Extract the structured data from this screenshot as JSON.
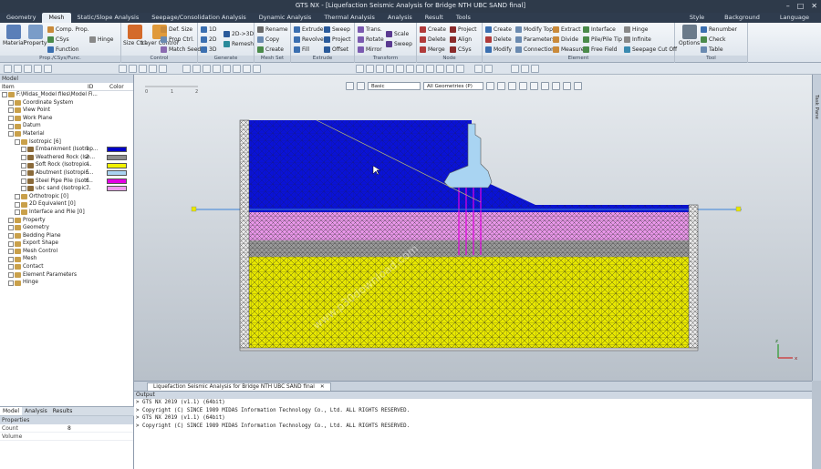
{
  "app": {
    "title": "GTS NX - [Liquefaction Seismic Analysis for Bridge NTH UBC SAND final]",
    "window_buttons": [
      "–",
      "□",
      "✕"
    ]
  },
  "menu": {
    "tabs": [
      "Geometry",
      "Mesh",
      "Static/Slope Analysis",
      "Seepage/Consolidation Analysis",
      "Dynamic Analysis",
      "Thermal Analysis",
      "Analysis",
      "Result",
      "Tools"
    ],
    "active": "Mesh",
    "right": [
      "Style",
      "Background",
      "Language"
    ]
  },
  "ribbon": {
    "groups": [
      {
        "label": "Prop./CSys/Func.",
        "items": [
          "Material",
          "Property",
          "Comp. Prop.",
          "CSys",
          "Function",
          "Hinge"
        ]
      },
      {
        "label": "Control",
        "items": [
          "Size Ctrl.",
          "Layer Control",
          "Def. Size",
          "Prop Ctrl.",
          "Match Seed"
        ]
      },
      {
        "label": "Generate",
        "items": [
          "1D",
          "2D",
          "3D",
          "2D->3D",
          "Remesh"
        ]
      },
      {
        "label": "Mesh Set",
        "items": [
          "Rename",
          "Copy",
          "Create"
        ]
      },
      {
        "label": "Extrude",
        "items": [
          "Extrude",
          "Revolve",
          "Fill",
          "Sweep",
          "Project",
          "Offset"
        ]
      },
      {
        "label": "Transform",
        "items": [
          "Trans.",
          "Rotate",
          "Mirror",
          "Scale",
          "Sweep"
        ]
      },
      {
        "label": "Node",
        "items": [
          "Create",
          "Delete",
          "Merge",
          "Project",
          "Align",
          "CSys"
        ]
      },
      {
        "label": "Element",
        "items": [
          "Create",
          "Delete",
          "Modify",
          "Modify Topo.",
          "Parameters",
          "Connection",
          "Extract",
          "Divide",
          "Measure",
          "Interface",
          "Pile/Pile Tip",
          "Free Field",
          "Hinge",
          "Infinite",
          "Seepage Cut Off"
        ]
      },
      {
        "label": "Tool",
        "items": [
          "Options",
          "Renumber",
          "Check",
          "Table"
        ]
      }
    ]
  },
  "model_panel": {
    "title": "Model",
    "columns": [
      "Item",
      "ID",
      "Color"
    ],
    "tree": [
      {
        "label": "F:\\Midas_Model files\\Model Fi...",
        "indent": 0
      },
      {
        "label": "Coordinate System",
        "indent": 1
      },
      {
        "label": "View Point",
        "indent": 1
      },
      {
        "label": "Work Plane",
        "indent": 1
      },
      {
        "label": "Datum",
        "indent": 1
      },
      {
        "label": "Material",
        "indent": 1
      },
      {
        "label": "Isotropic [6]",
        "indent": 2
      },
      {
        "label": "Embankment (Isotrop...",
        "indent": 3,
        "id": "1",
        "color": "#0000c8"
      },
      {
        "label": "Weathered Rock (Iso...",
        "indent": 3,
        "id": "2",
        "color": "#8d8d8d"
      },
      {
        "label": "Soft Rock (Isotropic...",
        "indent": 3,
        "id": "4",
        "color": "#f2f200"
      },
      {
        "label": "Abutment (Isotropic...",
        "indent": 3,
        "id": "5",
        "color": "#a9d4f2"
      },
      {
        "label": "Steel Pipe Pile (Isotr...",
        "indent": 3,
        "id": "6",
        "color": "#e200e2"
      },
      {
        "label": "ubc sand (Isotropic...",
        "indent": 3,
        "id": "7",
        "color": "#f09af0"
      },
      {
        "label": "Orthotropic [0]",
        "indent": 2
      },
      {
        "label": "2D Equivalent [0]",
        "indent": 2
      },
      {
        "label": "Interface and Pile [0]",
        "indent": 2
      },
      {
        "label": "Property",
        "indent": 1
      },
      {
        "label": "Geometry",
        "indent": 1
      },
      {
        "label": "Bedding Plane",
        "indent": 1
      },
      {
        "label": "Export Shape",
        "indent": 1
      },
      {
        "label": "Mesh Control",
        "indent": 1
      },
      {
        "label": "Mesh",
        "indent": 1
      },
      {
        "label": "Contact",
        "indent": 1
      },
      {
        "label": "Element Parameters",
        "indent": 1
      },
      {
        "label": "Hinge",
        "indent": 1
      }
    ],
    "tabs": [
      "Model",
      "Analysis",
      "Results"
    ]
  },
  "properties": {
    "title": "Properties",
    "rows": [
      {
        "k": "Count",
        "v": "8"
      },
      {
        "k": "Volume",
        "v": ""
      }
    ]
  },
  "viewport": {
    "view_select": "Basic",
    "geom_select": "All Geometries (P)",
    "scale_labels": [
      "0",
      "1",
      "2"
    ],
    "axis": [
      "z",
      "x"
    ],
    "task_pane": "Task Pane",
    "watermark": "www.p30download.com",
    "layers": [
      {
        "name": "Embankment",
        "color": "#0a12d6"
      },
      {
        "name": "ubc sand",
        "color": "#e996e9"
      },
      {
        "name": "Weathered Rock",
        "color": "#9a9a9a"
      },
      {
        "name": "Soft Rock",
        "color": "#e7e700"
      },
      {
        "name": "Abutment",
        "color": "#a9d4f2"
      },
      {
        "name": "Steel Pipe Pile",
        "color": "#e200e2"
      }
    ]
  },
  "doc_tab": {
    "label": "Liquefaction Seismic Analysis for Bridge NTH UBC SAND final",
    "close": "✕"
  },
  "output": {
    "title": "Output",
    "lines": [
      "> GTS NX 2019 (v1.1) (64bit)",
      "> Copyright (C) SINCE 1989 MIDAS Information Technology Co., Ltd. ALL RIGHTS RESERVED.",
      "> GTS NX 2019 (v1.1) (64bit)",
      "> Copyright (C) SINCE 1989 MIDAS Information Technology Co., Ltd. ALL RIGHTS RESERVED."
    ]
  }
}
